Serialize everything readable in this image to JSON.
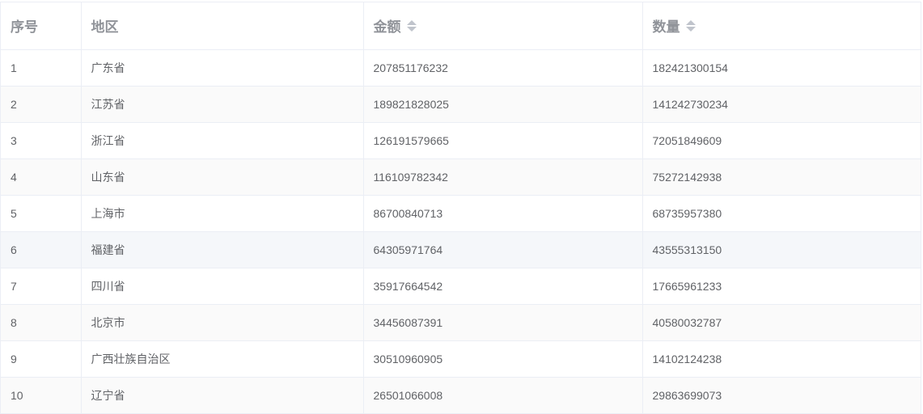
{
  "table": {
    "columns": [
      {
        "label": "序号",
        "sortable": false
      },
      {
        "label": "地区",
        "sortable": false
      },
      {
        "label": "金额",
        "sortable": true
      },
      {
        "label": "数量",
        "sortable": true
      }
    ],
    "rows": [
      {
        "index": "1",
        "region": "广东省",
        "amount": "207851176232",
        "quantity": "182421300154"
      },
      {
        "index": "2",
        "region": "江苏省",
        "amount": "189821828025",
        "quantity": "141242730234"
      },
      {
        "index": "3",
        "region": "浙江省",
        "amount": "126191579665",
        "quantity": "72051849609"
      },
      {
        "index": "4",
        "region": "山东省",
        "amount": "116109782342",
        "quantity": "75272142938"
      },
      {
        "index": "5",
        "region": "上海市",
        "amount": "86700840713",
        "quantity": "68735957380"
      },
      {
        "index": "6",
        "region": "福建省",
        "amount": "64305971764",
        "quantity": "43555313150"
      },
      {
        "index": "7",
        "region": "四川省",
        "amount": "35917664542",
        "quantity": "17665961233"
      },
      {
        "index": "8",
        "region": "北京市",
        "amount": "34456087391",
        "quantity": "40580032787"
      },
      {
        "index": "9",
        "region": "广西壮族自治区",
        "amount": "30510960905",
        "quantity": "14102124238"
      },
      {
        "index": "10",
        "region": "辽宁省",
        "amount": "26501066008",
        "quantity": "29863699073"
      }
    ],
    "colors": {
      "header_text": "#909399",
      "cell_text": "#606266",
      "border": "#ebeef5",
      "stripe": "#fafafa",
      "hover": "#f5f7fa",
      "sort_caret": "#c0c4cc"
    }
  }
}
